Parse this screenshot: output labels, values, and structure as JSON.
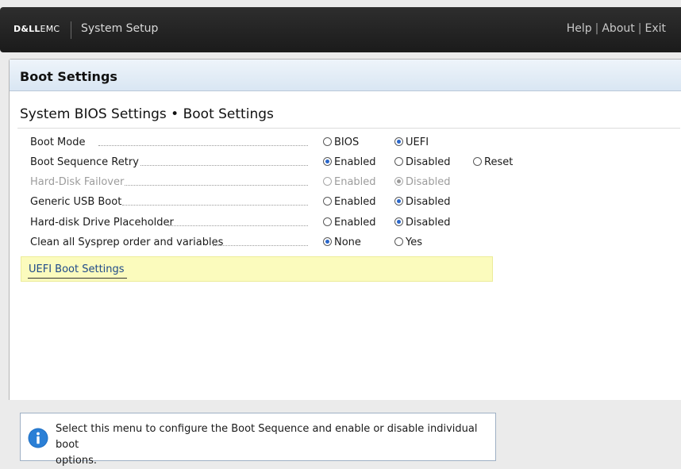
{
  "header": {
    "logo_dell": "D&LL",
    "logo_emc": "EMC",
    "app_title": "System Setup",
    "links": {
      "help": "Help",
      "about": "About",
      "exit": "Exit",
      "separator": "|"
    }
  },
  "page": {
    "title": "Boot Settings",
    "section_title": "System BIOS Settings • Boot Settings"
  },
  "settings": [
    {
      "label": "Boot Mode",
      "disabled": false,
      "options": [
        {
          "label": "BIOS",
          "selected": false
        },
        {
          "label": "UEFI",
          "selected": true
        }
      ]
    },
    {
      "label": "Boot Sequence Retry",
      "disabled": false,
      "options": [
        {
          "label": "Enabled",
          "selected": true
        },
        {
          "label": "Disabled",
          "selected": false
        },
        {
          "label": "Reset",
          "selected": false
        }
      ]
    },
    {
      "label": "Hard-Disk Failover",
      "disabled": true,
      "options": [
        {
          "label": "Enabled",
          "selected": false
        },
        {
          "label": "Disabled",
          "selected": true
        }
      ]
    },
    {
      "label": "Generic USB Boot",
      "disabled": false,
      "options": [
        {
          "label": "Enabled",
          "selected": false
        },
        {
          "label": "Disabled",
          "selected": true
        }
      ]
    },
    {
      "label": "Hard-disk Drive Placeholder",
      "disabled": false,
      "options": [
        {
          "label": "Enabled",
          "selected": false
        },
        {
          "label": "Disabled",
          "selected": true
        }
      ]
    },
    {
      "label": "Clean all Sysprep order and variables",
      "disabled": false,
      "options": [
        {
          "label": "None",
          "selected": true
        },
        {
          "label": "Yes",
          "selected": false
        }
      ]
    }
  ],
  "uefi_link": {
    "label": "UEFI Boot Settings"
  },
  "help": {
    "icon": "info-icon",
    "text_line1": "Select this menu to configure the Boot Sequence and enable or disable individual boot",
    "text_line2": "options."
  },
  "colors": {
    "accent": "#2a66c9",
    "highlight": "#fbfbbd",
    "header_bg": "#1b1b1b"
  }
}
